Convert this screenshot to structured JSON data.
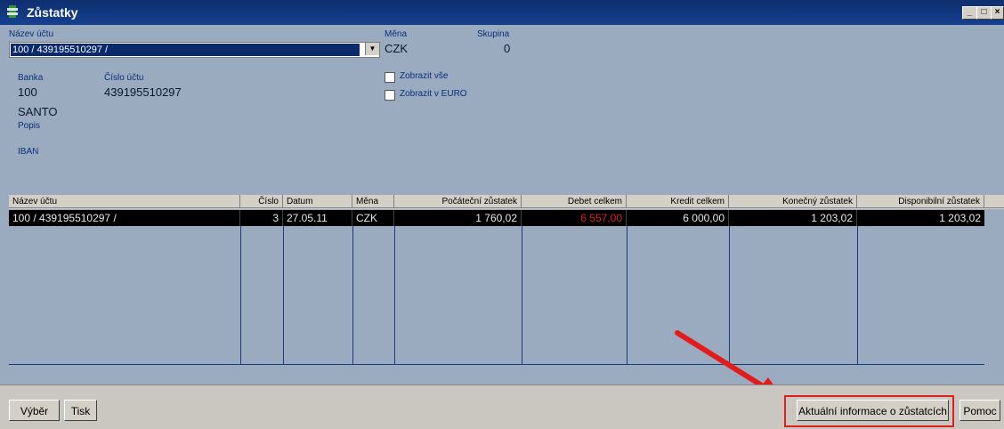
{
  "window": {
    "title": "Zůstatky",
    "controls": [
      "_",
      "□",
      "×"
    ]
  },
  "form": {
    "account_name_label": "Název účtu",
    "account_name_value": "100 / 439195510297 /",
    "currency_label": "Měna",
    "currency_value": "CZK",
    "group_label": "Skupina",
    "group_value": "0",
    "bank_label": "Banka",
    "bank_value": "100",
    "bank_name": "SANTO",
    "account_number_label": "Číslo účtu",
    "account_number_value": "439195510297",
    "description_label": "Popis",
    "iban_label": "IBAN",
    "show_all_label": "Zobrazit vše",
    "show_euro_label": "Zobrazit v EURO"
  },
  "table": {
    "headers": [
      "Název účtu",
      "Číslo",
      "Datum",
      "Měna",
      "Počáteční zůstatek",
      "Debet celkem",
      "Kredit celkem",
      "Konečný zůstatek",
      "Disponibilní zůstatek"
    ],
    "rows": [
      [
        "100 / 439195510297 /",
        "3",
        "27.05.11",
        "CZK",
        "1 760,02",
        "6 557,00",
        "6 000,00",
        "1 203,02",
        "1 203,02"
      ]
    ]
  },
  "footer": {
    "select_label": "Výběr",
    "print_label": "Tisk",
    "current_info_label": "Aktuální informace o zůstatcích",
    "help_label": "Pomoc"
  },
  "colors": {
    "debit_value": "#e02020",
    "highlight": "#e02020"
  }
}
